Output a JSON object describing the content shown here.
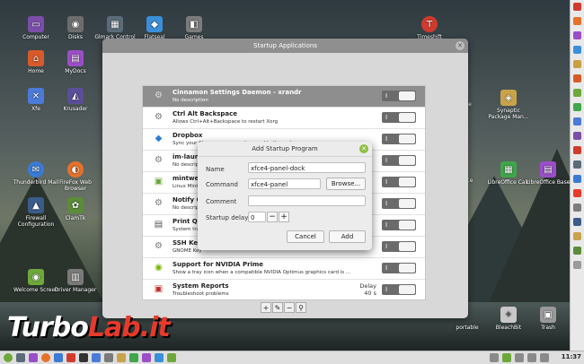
{
  "desktop": {
    "icons": [
      {
        "label": "Computer",
        "color": "#7a4ea8",
        "glyph": "▭"
      },
      {
        "label": "Disks",
        "color": "#6d6d6d",
        "glyph": "◉"
      },
      {
        "label": "Glmark Control",
        "color": "#5a6c7a",
        "glyph": "▦"
      },
      {
        "label": "Flatseal",
        "color": "#3a8fd8",
        "glyph": "◆"
      },
      {
        "label": "Games",
        "color": "#7c7c7c",
        "glyph": "◧"
      },
      {
        "label": "Timeshift",
        "color": "#d13b2e",
        "glyph": "T"
      },
      {
        "label": "Home",
        "color": "#d85a2a",
        "glyph": "⌂"
      },
      {
        "label": "MyDocs",
        "color": "#9b4ec8",
        "glyph": "▤"
      },
      {
        "label": "Xfe",
        "color": "#4b7bd8",
        "glyph": "✕"
      },
      {
        "label": "Krusader",
        "color": "#5a4e9a",
        "glyph": "◭"
      },
      {
        "label": "Synaptic Package Man...",
        "color": "#c9a34a",
        "glyph": "◈"
      },
      {
        "label": "Thunderbird Mail",
        "color": "#3a7bd5",
        "glyph": "✉"
      },
      {
        "label": "FireFox Web Browser",
        "color": "#e8712a",
        "glyph": "◐"
      },
      {
        "label": "LibreOffice Calc",
        "color": "#3ea64b",
        "glyph": "▦"
      },
      {
        "label": "LibreOffice Base",
        "color": "#9b4ec8",
        "glyph": "▤"
      },
      {
        "label": "Firewall Configuration",
        "color": "#3b5c8a",
        "glyph": "▲"
      },
      {
        "label": "ClamTk",
        "color": "#5b8c3a",
        "glyph": "✿"
      },
      {
        "label": "Welcome Screen",
        "color": "#6fa83a",
        "glyph": "◉"
      },
      {
        "label": "Driver Manager",
        "color": "#7a7a7a",
        "glyph": "▥"
      },
      {
        "label": "BleachBit",
        "color": "#c8c8c8",
        "glyph": "✦"
      },
      {
        "label": "Trash",
        "color": "#9a9a9a",
        "glyph": "▣"
      }
    ],
    "partial_labels": [
      "ate",
      "ffice",
      "portable"
    ]
  },
  "bg_window": {
    "title": "Startup Applications"
  },
  "startup_list": [
    {
      "name": "Cinnamon Settings Daemon - xrandr",
      "desc": "No description",
      "icon": "gears-icon",
      "state": "I",
      "selected": true
    },
    {
      "name": "Ctrl Alt Backspace",
      "desc": "Allows Ctrl+Alt+Backspace to restart Xorg",
      "icon": "gears-icon",
      "state": "I"
    },
    {
      "name": "Dropbox",
      "desc": "Sync your files across computers and to the web",
      "icon": "dropbox-icon",
      "state": "I"
    },
    {
      "name": "im-launch",
      "desc": "No descript",
      "icon": "gears-icon",
      "state": "I"
    },
    {
      "name": "mintwelco",
      "desc": "Linux Mint W",
      "icon": "mint-icon",
      "state": "I"
    },
    {
      "name": "Notify Cl",
      "desc": "No descript",
      "icon": "gears-icon",
      "state": "I"
    },
    {
      "name": "Print Que",
      "desc": "System tray",
      "icon": "printer-icon",
      "state": "I"
    },
    {
      "name": "SSH Key A",
      "desc": "GNOME Key",
      "icon": "gears-icon",
      "state": "I"
    },
    {
      "name": "Support for NVIDIA Prime",
      "desc": "Show a tray icon when a compatible NVIDIA Optimus graphics card is ...",
      "icon": "nvidia-icon",
      "state": "I"
    },
    {
      "name": "System Reports",
      "desc": "Troubleshoot problems",
      "icon": "report-icon",
      "state": "I",
      "delay_label": "Delay",
      "delay_value": "40 s"
    }
  ],
  "toolbar": [
    "+",
    "✎",
    "−",
    "⚲"
  ],
  "dialog": {
    "title": "Add Startup Program",
    "name_label": "Name",
    "name_value": "xfce4-panel-dock",
    "command_label": "Command",
    "command_value": "xfce4-panel",
    "browse_label": "Browse...",
    "comment_label": "Comment",
    "comment_value": "",
    "delay_label": "Startup delay",
    "delay_value": "0",
    "minus": "−",
    "plus": "+",
    "cancel_label": "Cancel",
    "add_label": "Add"
  },
  "taskbar": {
    "clock": "11:37"
  },
  "watermark": {
    "part1": "Turbo",
    "part2": "Lab.it"
  },
  "colors": {
    "accent": "#8fbf3f",
    "switch": "#6b6b6b",
    "selected_row": "#8e8e8e"
  }
}
